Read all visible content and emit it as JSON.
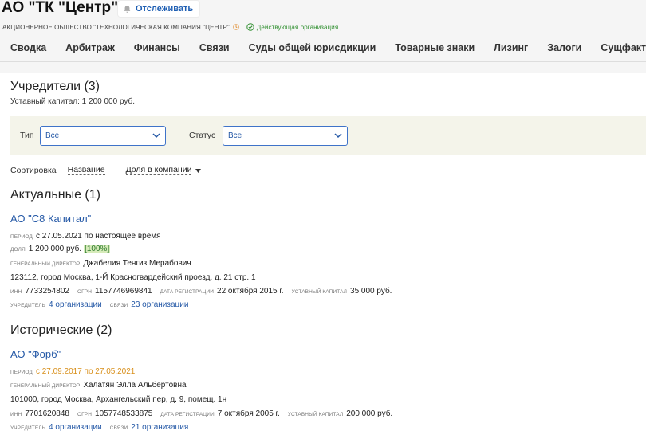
{
  "header": {
    "title": "АО \"ТК \"Центр\"",
    "follow_label": "Отслеживать",
    "full_name": "АКЦИОНЕРНОЕ ОБЩЕСТВО \"ТЕХНОЛОГИЧЕСКАЯ КОМПАНИЯ \"ЦЕНТР\"",
    "status": "Действующая организация"
  },
  "nav": [
    "Сводка",
    "Арбитраж",
    "Финансы",
    "Связи",
    "Суды общей юрисдикции",
    "Товарные знаки",
    "Лизинг",
    "Залоги",
    "Сущфакты"
  ],
  "founders": {
    "heading": "Учредители (3)",
    "capital": "Уставный капитал: 1 200 000 руб.",
    "filter_type_label": "Тип",
    "filter_type_value": "Все",
    "filter_status_label": "Статус",
    "filter_status_value": "Все",
    "sort_label": "Сортировка",
    "sort_name": "Название",
    "sort_share": "Доля в компании"
  },
  "actual": {
    "heading": "Актуальные (1)",
    "name": "АО \"С8 Капитал\"",
    "period_label": "период",
    "period": "с 27.05.2021 по настоящее время",
    "share_label": "доля",
    "share": "1 200 000 руб.",
    "share_pct": "[100%]",
    "director_label": "генеральный директор",
    "director": "Джабелия Тенгиз Мерабович",
    "address": "123112, город Москва, 1-Й Красногвардейский проезд, д. 21 стр. 1",
    "inn_label": "инн",
    "inn": "7733254802",
    "ogrn_label": "огрн",
    "ogrn": "1157746969841",
    "reg_label": "дата регистрации",
    "reg": "22 октября 2015 г.",
    "capital_label": "уставный капитал",
    "capital": "35 000 руб.",
    "founder_label": "учредитель",
    "founder": "4 организации",
    "links_label": "связи",
    "links": "23 организации"
  },
  "historical": {
    "heading": "Исторические (2)",
    "name": "АО \"Форб\"",
    "period_label": "период",
    "period": "с 27.09.2017 по 27.05.2021",
    "director_label": "генеральный директор",
    "director": "Халатян Элла Альбертовна",
    "address": "101000, город Москва, Архангельский пер, д. 9, помещ. 1н",
    "inn_label": "инн",
    "inn": "7701620848",
    "ogrn_label": "огрн",
    "ogrn": "1057748533875",
    "reg_label": "дата регистрации",
    "reg": "7 октября 2005 г.",
    "capital_label": "уставный капитал",
    "capital": "200 000 руб.",
    "founder_label": "учредитель",
    "founder": "4 организации",
    "links_label": "связи",
    "links": "21 организация"
  }
}
